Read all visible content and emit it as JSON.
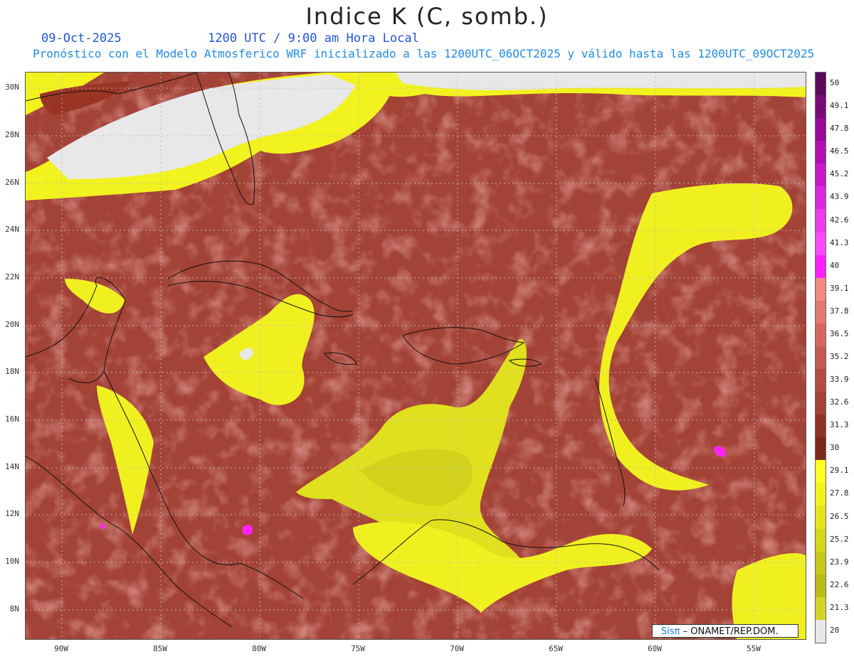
{
  "header": {
    "title": "Indice K (C, somb.)",
    "date": "09-Oct-2025",
    "time": "1200 UTC / 9:00 am Hora Local",
    "description": "Pronóstico con el Modelo Atmosferico WRF inicializado a las 1200UTC_06OCT2025 y válido hasta las  1200UTC_09OCT2025"
  },
  "map": {
    "lat_labels": [
      "30N",
      "28N",
      "26N",
      "24N",
      "22N",
      "20N",
      "18N",
      "16N",
      "14N",
      "12N",
      "10N",
      "8N"
    ],
    "lon_labels": [
      "90W",
      "85W",
      "80W",
      "75W",
      "70W",
      "65W",
      "60W",
      "55W"
    ],
    "credit_logo": "Sisπ",
    "credit_text": " – ONAMET/REP.DOM.",
    "colors": {
      "no_data": "#e8e8e8",
      "low": "#f0f020",
      "mid": "#9a3a28",
      "high": "#c85a50",
      "peak": "#ff33ff"
    }
  },
  "colorbar": {
    "labels": [
      "50",
      "49.1",
      "47.8",
      "46.5",
      "45.2",
      "43.9",
      "42.6",
      "41.3",
      "40",
      "39.1",
      "37.8",
      "36.5",
      "35.2",
      "33.9",
      "32.6",
      "31.3",
      "30",
      "29.1",
      "27.8",
      "26.5",
      "25.2",
      "23.9",
      "22.6",
      "21.3",
      "20"
    ],
    "colors": [
      "#5a0a5a",
      "#7a0a7a",
      "#960a96",
      "#b010b0",
      "#c818c8",
      "#dc28dc",
      "#ec3cec",
      "#fa4cfa",
      "#ff22ff",
      "#f08a84",
      "#e27870",
      "#d46860",
      "#c45a50",
      "#b44c42",
      "#a34236",
      "#8f3424",
      "#7a2a18",
      "#ffff22",
      "#f2f21e",
      "#e4e41c",
      "#d6d61a",
      "#c8c818",
      "#bcbc16",
      "#d4d428",
      "#e8e8e8"
    ]
  }
}
